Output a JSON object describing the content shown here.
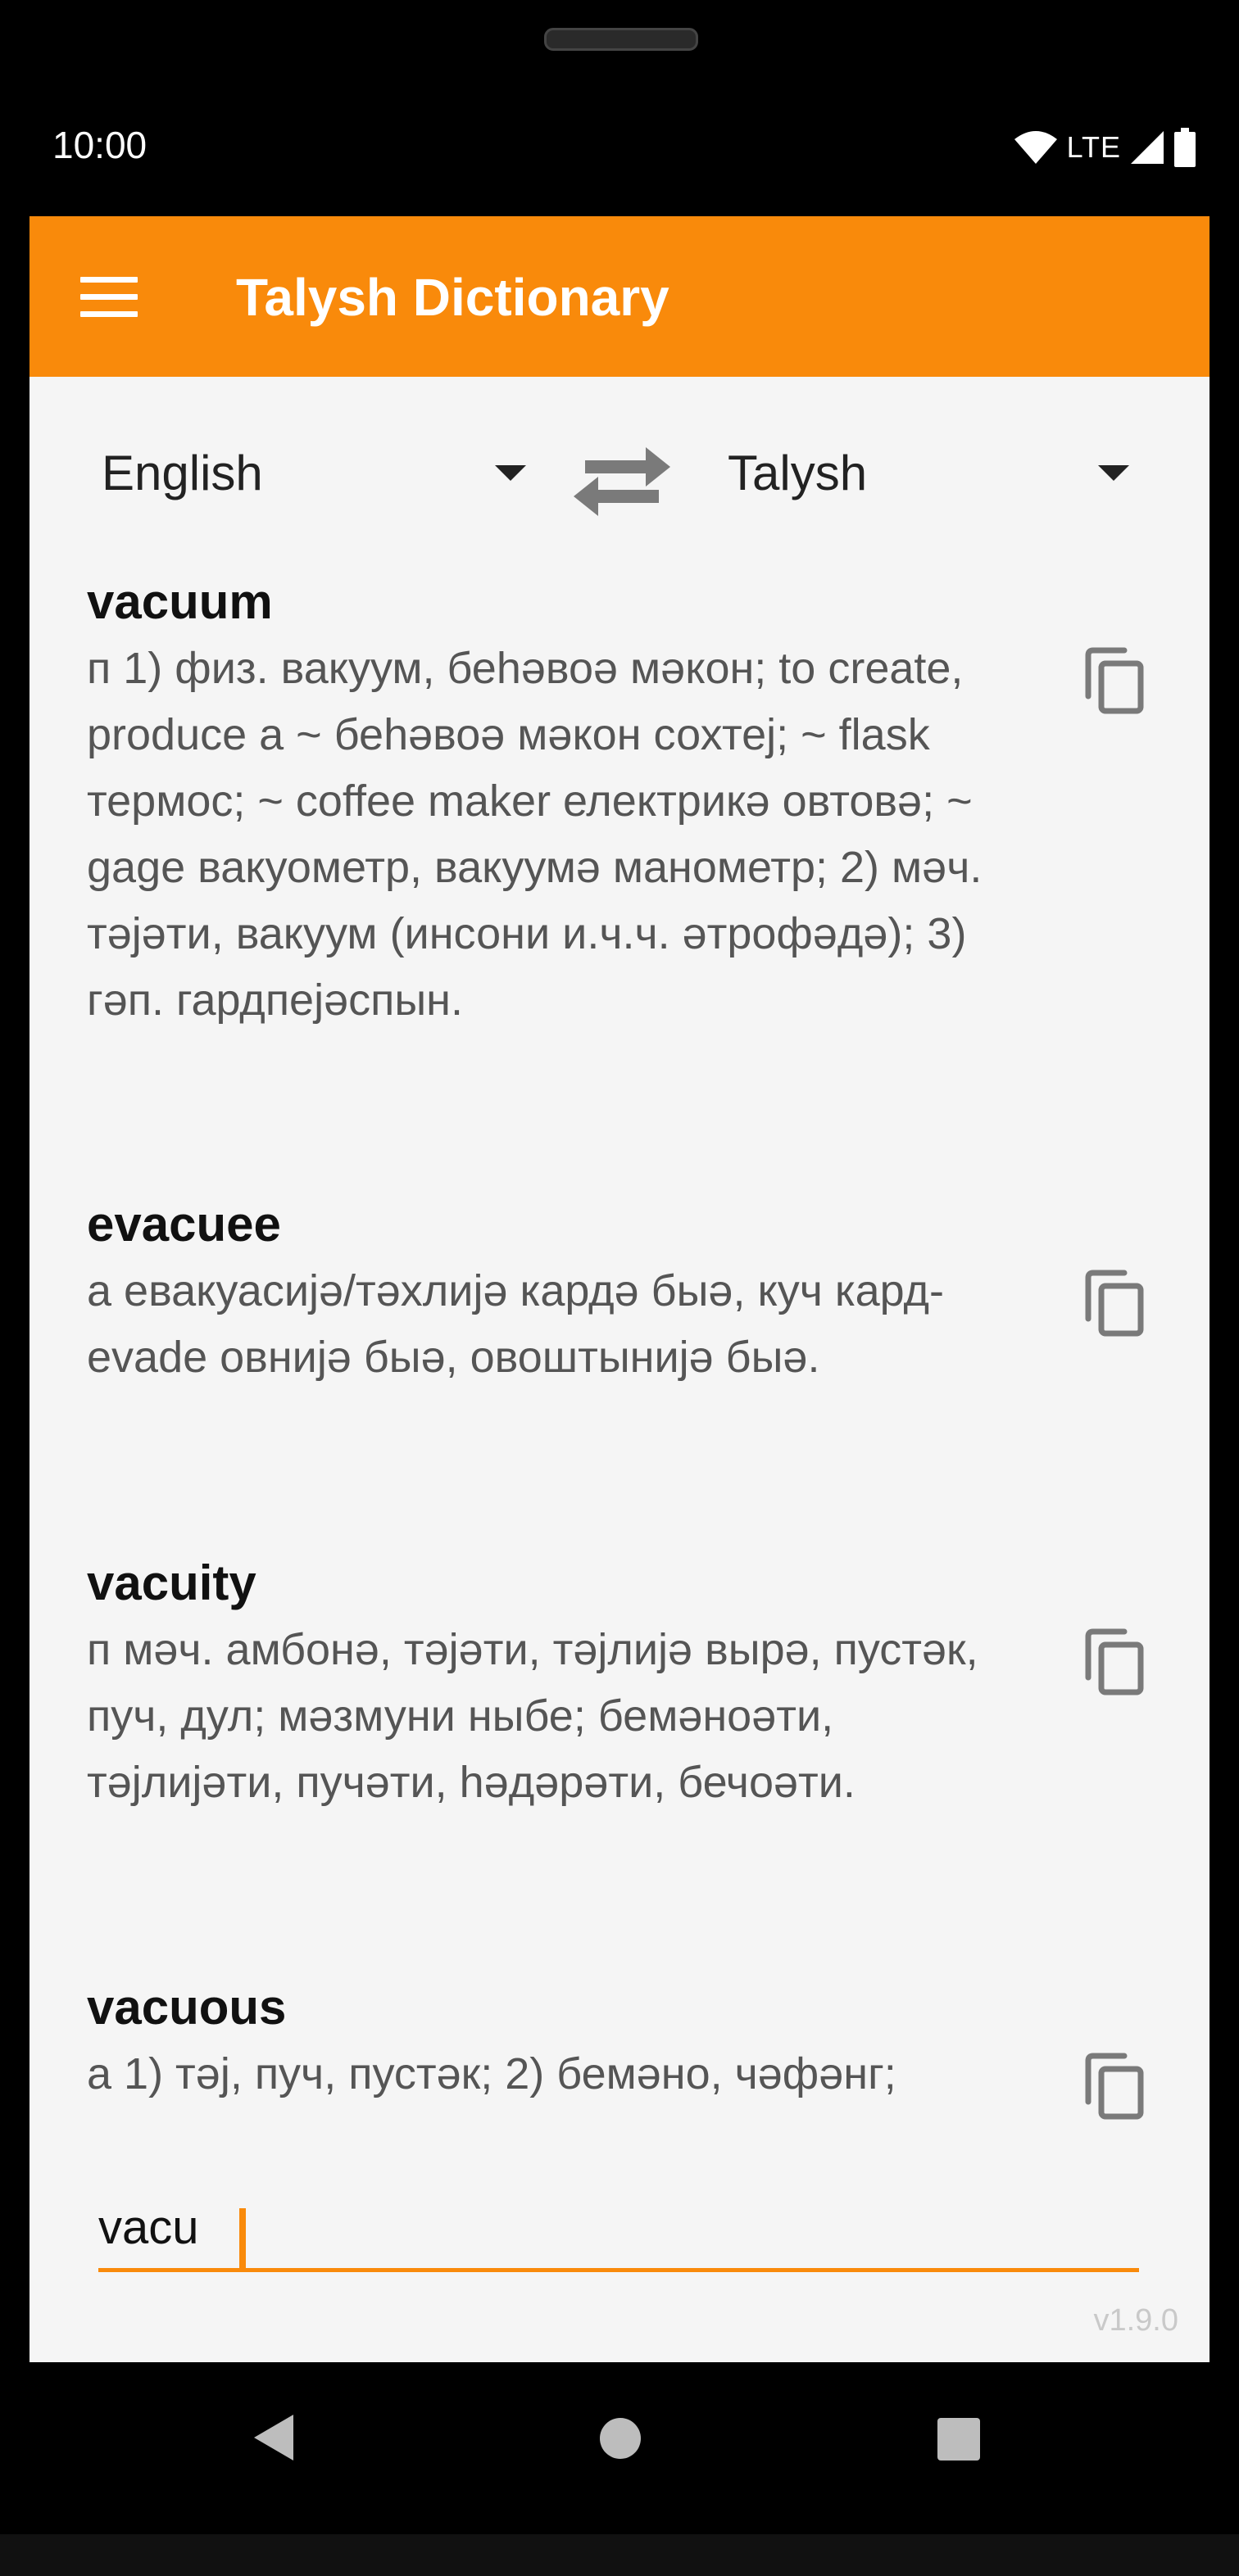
{
  "status_bar": {
    "time": "10:00",
    "network": "LTE"
  },
  "app_bar": {
    "title": "Talysh Dictionary"
  },
  "languages": {
    "from": "English",
    "to": "Talysh"
  },
  "entries": [
    {
      "word": "vacuum",
      "definition": " п 1) физ. вакуум, беhəвоə мəкон; to create, produce a ~ беhəвоə мəкон сохтеj; ~ flask термос; ~ coffee maker електрикə овтовə; ~ gage вакуометр, вакуумə манометр; 2) мəч. тəjəти, вакуум (инсони и.ч.ч. əтрофəдə); 3) гəп. гардпеjəспын."
    },
    {
      "word": "evacuee",
      "definition": " а евакуасиjə/тəхлиjə кардə быə, куч кард- evade  овниjə быə, овоштыниjə быə."
    },
    {
      "word": "vacuity",
      "definition": " п мəч. амбонə, тəjəти, тəjлиjə вырə, пустəк, пуч, дул; мəзмуни ныбе; бемəноəти, тəjлиjəти, пучəти, həдəрəти, бечоəти."
    },
    {
      "word": "vacuous",
      "definition": " а 1) тəj, пуч, пустəк; 2) бемəно, чəфəнг;"
    }
  ],
  "search": {
    "value": "vacu"
  },
  "version": "v1.9.0",
  "colors": {
    "accent": "#f98a0b",
    "background": "#f5f5f5"
  }
}
